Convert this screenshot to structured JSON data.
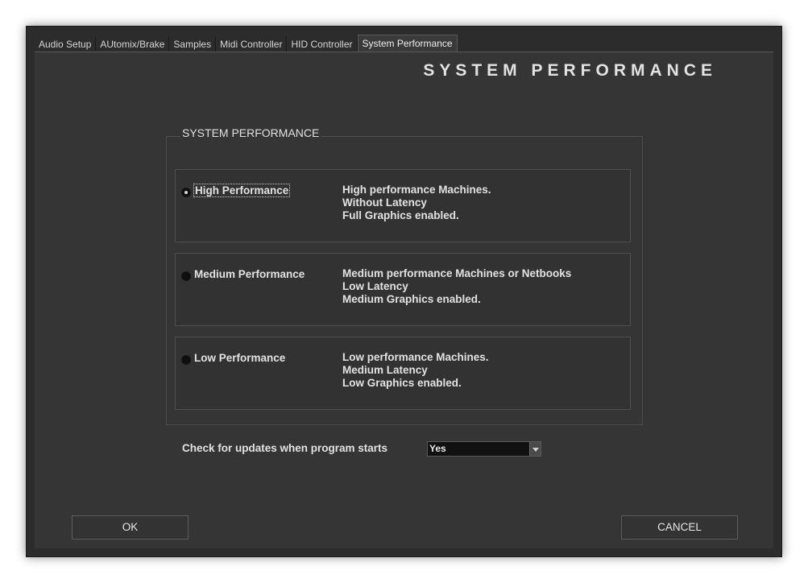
{
  "tabs": [
    {
      "label": "Audio Setup",
      "active": false
    },
    {
      "label": "AUtomix/Brake",
      "active": false
    },
    {
      "label": "Samples",
      "active": false
    },
    {
      "label": "Midi Controller",
      "active": false
    },
    {
      "label": "HID Controller",
      "active": false
    },
    {
      "label": "System Performance",
      "active": true
    }
  ],
  "page_title": "SYSTEM PERFORMANCE",
  "group": {
    "title": "SYSTEM PERFORMANCE",
    "selected": "high",
    "options": [
      {
        "id": "high",
        "label": "High Performance",
        "description": [
          "High performance Machines.",
          "Without Latency",
          "Full Graphics enabled."
        ]
      },
      {
        "id": "medium",
        "label": "Medium Performance",
        "description": [
          "Medium performance Machines or Netbooks",
          "Low Latency",
          "Medium Graphics enabled."
        ]
      },
      {
        "id": "low",
        "label": "Low Performance",
        "description": [
          "Low performance Machines.",
          "Medium Latency",
          "Low Graphics enabled."
        ]
      }
    ]
  },
  "updates": {
    "label": "Check for updates when program starts",
    "value": "Yes"
  },
  "buttons": {
    "ok": "OK",
    "cancel": "CANCEL"
  }
}
